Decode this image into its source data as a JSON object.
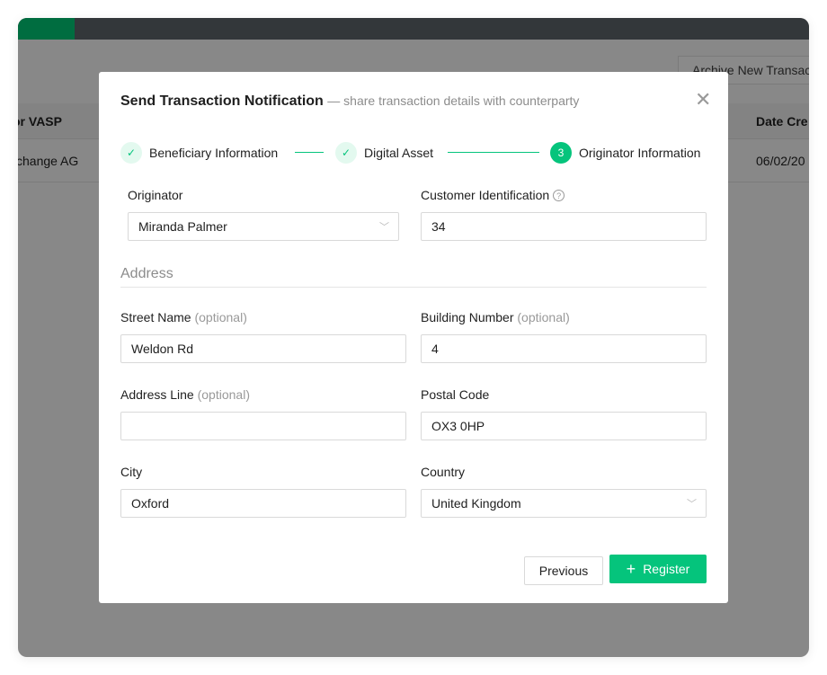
{
  "background": {
    "archive_button": "Archive New Transac",
    "columns": [
      "or VASP",
      "Date Cre"
    ],
    "row": [
      "change AG",
      "06/02/20"
    ]
  },
  "modal": {
    "title": "Send Transaction Notification",
    "subtitle": "— share transaction details with counterparty",
    "close_icon": "close-icon",
    "steps": [
      {
        "label": "Beneficiary Information",
        "status": "done",
        "icon": "✓"
      },
      {
        "label": "Digital Asset",
        "status": "done",
        "icon": "✓"
      },
      {
        "label": "Originator Information",
        "status": "current",
        "number": "3"
      }
    ],
    "originator": {
      "label": "Originator",
      "value": "Miranda Palmer"
    },
    "customer_id": {
      "label": "Customer Identification",
      "help": "?",
      "value": "34"
    },
    "address_title": "Address",
    "optional": "(optional)",
    "street": {
      "label": "Street Name",
      "value": "Weldon Rd"
    },
    "building": {
      "label": "Building Number",
      "value": "4"
    },
    "address_line": {
      "label": "Address Line",
      "value": ""
    },
    "postal": {
      "label": "Postal Code",
      "value": "OX3 0HP"
    },
    "city": {
      "label": "City",
      "value": "Oxford"
    },
    "country": {
      "label": "Country",
      "value": "United Kingdom"
    },
    "previous": "Previous",
    "register": "Register",
    "register_icon": "+"
  },
  "colors": {
    "accent": "#05c47c",
    "brand": "#006d40"
  }
}
